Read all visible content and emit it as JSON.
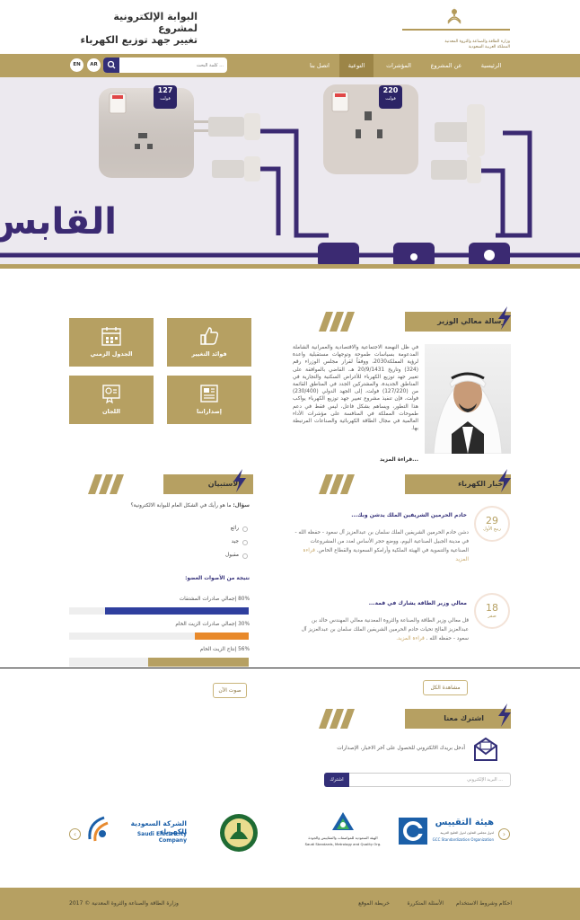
{
  "header": {
    "portal_title_line1": "البوابة الإلكترونية لمشروع",
    "portal_title_line2": "تغيير جهد توزيع الكهرباء",
    "ministry_line1": "وزارة الطاقة والصناعة والثروة المعدنية",
    "ministry_line2": "المملكة العربية السعودية"
  },
  "nav": {
    "items": [
      "الرئيسية",
      "عن المشروع",
      "المؤشرات",
      "التوعية",
      "اتصل بنا"
    ],
    "lang_ar": "AR",
    "lang_en": "EN",
    "search_placeholder": "كلمة البحث ..."
  },
  "hero": {
    "socket1_voltage": "127",
    "socket2_voltage": "220",
    "unit": "فولت",
    "caption": "القابس"
  },
  "minister": {
    "heading": "رسالة معالي الوزير",
    "text": "في ظل النهضة الاجتماعية والاقتصادية والعمرانية الشاملة المدعومة بسياسات طموحة وتوجهات مستقبلية واعدة لرؤية المملكة2030، ووفقاً لقرار مجلس الوزراء رقم (324) وتاريخ 20/9/1431 هـ، القاضي بالموافقة على تغيير جهد توزيع الكهرباء للأغراض السكنية والتجارية في المناطق الجديدة، والمشتركين الجدد في المناطق القائمة من (127/220) فولت، إلى الجهد الدولي (230/400) فولت، فإن تنفيذ مشروع تغيير جهد توزيع الكهرباء يواكب هذا التطور، ويساهم بشكل فاعل، ليس فقط في دعم طموحات المملكة في المنافسة على مؤشرات الأداء العالمية في مجال الطاقة الكهربائية والصناعات المرتبطة بها.",
    "more": "قراءة المزيد..."
  },
  "tiles": [
    {
      "label": "فوائد التغيير",
      "icon": "thumbs-up-icon"
    },
    {
      "label": "الجدول الزمني",
      "icon": "calendar-icon"
    },
    {
      "label": "إصداراتنا",
      "icon": "publications-icon"
    },
    {
      "label": "اللجان",
      "icon": "committee-icon"
    }
  ],
  "news": {
    "heading": "أخبار الكهرباء",
    "items": [
      {
        "day": "29",
        "month": "ربيع الأول",
        "title": "خادم الحرمين الشريفين الملك يدشن وبك...",
        "body": "دشن خادم الحرمين الشريفين الملك سلمان بن عبدالعزيز آل سعود - حفظه الله - في مدينة الجبيل الصناعية اليوم، ووضع حجر الأساس لعدد من المشروعات الصناعية والتنموية في الهيئة الملكية وأرامكو السعودية والقطاع الخاص.",
        "more": "قراءة المزيد"
      },
      {
        "day": "18",
        "month": "صفر",
        "title": "معالي وزير الطاقة يشارك في قمة...",
        "body": "قل معالي وزير الطاقة والصناعة والثروة المعدنية معالي المهندس خالد بن عبدالعزيز الفالح تحيات خادم الحرمين الشريفين الملك سلمان بن عبدالعزيز آل سعود - حفظه الله .",
        "more": "قراءة المزيد."
      }
    ],
    "view_all": "مشاهدة الكل"
  },
  "poll": {
    "heading": "الاستبيان",
    "question_label": "سؤال:",
    "question": "ما هو رأيك في الشكل العام للبوابة الالكترونية؟",
    "options": [
      "رائع",
      "جيد",
      "مقبول"
    ],
    "results_title": "نتيجة من الأصوات العضو:",
    "results": [
      {
        "label": "إجمالي صادرات المشتقات",
        "percent": 80,
        "color": "#2f3f9e"
      },
      {
        "label": "إجمالي صادرات الزيت الخام",
        "percent": 30,
        "color": "#e8892a"
      },
      {
        "label": "إنتاج الزيت الخام",
        "percent": 56,
        "color": "#b6a062"
      }
    ],
    "vote_button": "صوت الآن"
  },
  "subscribe": {
    "heading": "اشترك معنا",
    "description": "أدخل بريدك الالكتروني للحصول على آخر الاخبار، الإصدارات",
    "placeholder": "البريد الإلكتروني ...",
    "button": "اشترك"
  },
  "partners": {
    "saso_ar": "الهيئة السعودية للمواصفات والمقاييس والجودة",
    "saso_en": "Saudi Standards, Metrology and Quality Org.",
    "gso_ar": "هيئة التقييس",
    "gso_sub": "لدول مجلس التعاون لدول الخليج العربية",
    "gso_en": "GCC Standardization Organization",
    "sec_ar": "الشركة السعودية للكهرباء",
    "sec_en": "Saudi Electricity Company"
  },
  "footer": {
    "links": [
      "احكام وشروط الاستخدام",
      "الأسئلة المتكررة",
      "خريطة الموقع"
    ],
    "copyright": "وزارة الطاقة والصناعة والثروة المعدنية © 2017"
  }
}
